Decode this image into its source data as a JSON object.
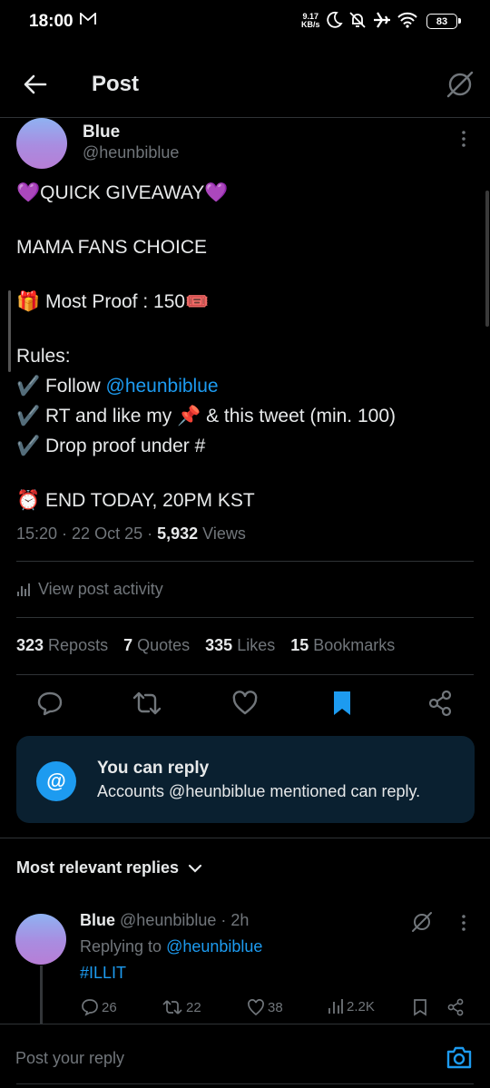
{
  "status_bar": {
    "time": "18:00",
    "speed_value": "9.17",
    "speed_unit": "KB/s",
    "battery": "83",
    "icons": [
      "mail-icon",
      "dnd-moon-icon",
      "bell-off-icon",
      "airplane-icon",
      "wifi-icon",
      "battery-icon"
    ]
  },
  "header": {
    "title": "Post"
  },
  "post": {
    "author_name": "Blue",
    "author_handle": "@heunbiblue",
    "lines": {
      "l1": "💜QUICK GIVEAWAY💜",
      "l2": "MAMA FANS CHOICE",
      "l3_prefix": "🎁 Most Proof : 150",
      "l3_suffix": "🎟️",
      "l4": "Rules:",
      "l5_prefix": "✔️ Follow ",
      "l5_link": "@heunbiblue",
      "l6": "✔️ RT and like my 📌 & this tweet (min. 100)",
      "l7": "✔️ Drop proof under #",
      "l8": "⏰ END TODAY, 20PM KST"
    },
    "time": "15:20",
    "date": "22 Oct 25",
    "views_count": "5,932",
    "views_label": "Views"
  },
  "activity_label": "View post activity",
  "stats": {
    "reposts_count": "323",
    "reposts_label": "Reposts",
    "quotes_count": "7",
    "quotes_label": "Quotes",
    "likes_count": "335",
    "likes_label": "Likes",
    "bookmarks_count": "15",
    "bookmarks_label": "Bookmarks"
  },
  "reply_permission": {
    "title": "You can reply",
    "description": "Accounts @heunbiblue mentioned can reply.",
    "icon_glyph": "@"
  },
  "replies_sort_label": "Most relevant replies",
  "reply": {
    "name": "Blue",
    "handle": "@heunbiblue",
    "age": "2h",
    "replying_prefix": "Replying to ",
    "replying_to": "@heunbiblue",
    "text": "#ILLIT",
    "replies": "26",
    "reposts": "22",
    "likes": "38",
    "views": "2.2K"
  },
  "composer": {
    "placeholder": "Post your reply"
  },
  "colors": {
    "accent": "#1d9bf0",
    "muted": "#71767b",
    "background": "#000000"
  }
}
